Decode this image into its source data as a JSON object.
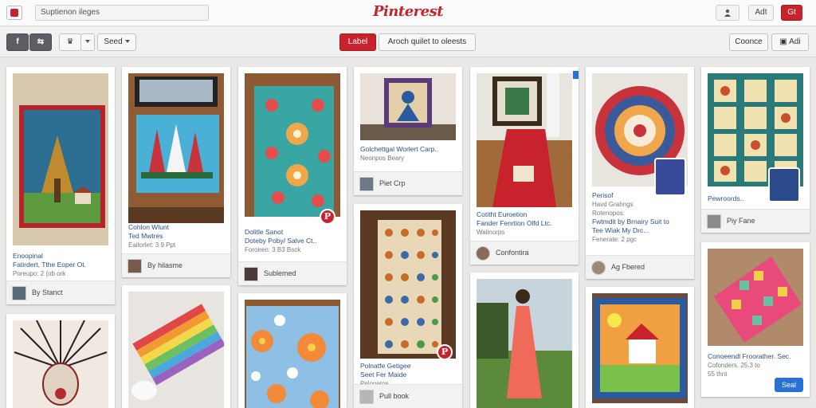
{
  "header": {
    "search_text": "Suptienon ileges",
    "logo": "Pinterest",
    "button_1": "",
    "button_2": "Adt",
    "button_3": "Gt"
  },
  "toolbar": {
    "seed_label": "Seed",
    "label_button": "Label",
    "action_button": "Aroch quilet to oleests",
    "cancel_button": "Coonce",
    "add_button": "Adi"
  },
  "pins": [
    {
      "line1": "Enoopinal",
      "line2": "Fatirdert, Tthe Eoper Ot.",
      "line3": "Poreupo: 2 (ob ork",
      "foot": "By Stanct"
    },
    {
      "line1": "Cohlon Wlunt",
      "line2": "Ted Mwtres",
      "line3": "Eaitorlet: 3 9 Ppt",
      "foot": "By hilasme"
    },
    {
      "line1": "Dolitle Sanot",
      "line2": "Doteby Poby/ Salve Ct..",
      "line3": "Foroiren: 3 B3 Bsck",
      "foot": "Sublemed"
    },
    {
      "line1": "Golchettgal Worlert Carp..",
      "line2": "Neonpos Beary",
      "line3": "",
      "foot": "Piet Crp"
    },
    {
      "line1": "Polnatfe Getigee",
      "line2": "Seet Fer Maide",
      "line3": "Pelopetos",
      "foot": "Pull book"
    },
    {
      "line1": "Cotitht Euroetion",
      "line2": "Fander Fenrtion Olfd Ltc.",
      "line3": "Walinorps",
      "foot": "Confontira"
    },
    {
      "line1": "Perisof",
      "line2": "Havd Grahngs",
      "line3": "Rotenopos:",
      "line4": "Fwtmdit by Brnairy Suit to",
      "line5": "Tee Wiak My Drc...",
      "line6": "Fenerate: 2 pgc",
      "foot": "Ag Fbered"
    },
    {
      "line1": "Pewroords..",
      "line2": "",
      "line3": "",
      "foot": "Piy Fane"
    },
    {
      "line1": "Conoeendl Froorather. Sec.",
      "line2": "Cofonders. 25.3 to",
      "line3": "55 thnt",
      "button": "Seal"
    }
  ],
  "colors": {
    "brand": "#c8232c",
    "link": "#2a4f8a"
  }
}
